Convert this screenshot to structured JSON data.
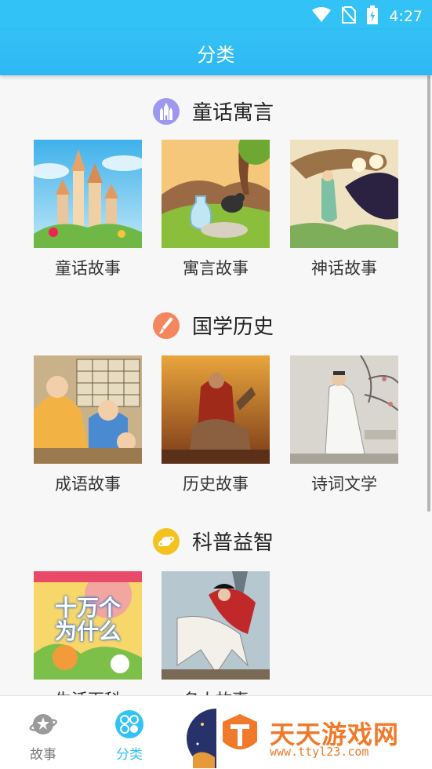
{
  "status": {
    "time": "4:27"
  },
  "header": {
    "title": "分类"
  },
  "sections": [
    {
      "title": "童话寓言",
      "icon": "castle-icon",
      "color": "#9d97f0",
      "items": [
        "童话故事",
        "寓言故事",
        "神话故事"
      ]
    },
    {
      "title": "国学历史",
      "icon": "brush-icon",
      "color": "#f5875f",
      "items": [
        "成语故事",
        "历史故事",
        "诗词文学"
      ]
    },
    {
      "title": "科普益智",
      "icon": "planet-icon",
      "color": "#f4c21f",
      "items": [
        "生活百科",
        "名人故事"
      ]
    }
  ],
  "thumb_texts": {
    "book_title": "十万个\n为什么"
  },
  "tabs": [
    {
      "label": "故事",
      "active": false
    },
    {
      "label": "分类",
      "active": true
    }
  ],
  "colors": {
    "primary": "#33c2f6",
    "active_tab": "#33c2f6",
    "inactive_tab": "#7a7a7a"
  },
  "watermark": {
    "name": "天天游戏网",
    "url": "www.ttyl23.com"
  }
}
